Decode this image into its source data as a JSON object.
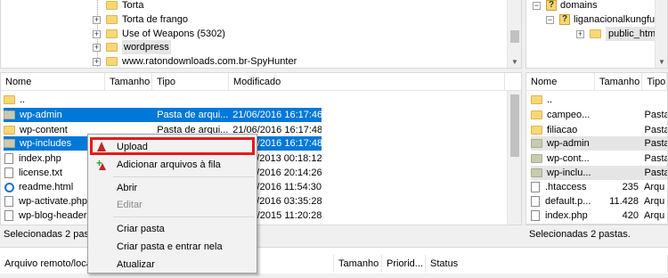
{
  "local_tree": {
    "items": [
      {
        "label": "Torta"
      },
      {
        "label": "Torta de frango"
      },
      {
        "label": "Use of Weapons (5302)"
      },
      {
        "label": "wordpress"
      },
      {
        "label": "www.ratondownloads.com.br-SpyHunter"
      }
    ]
  },
  "remote_tree": {
    "items": [
      {
        "label": "domains"
      },
      {
        "label": "liganacionalkungfu."
      },
      {
        "label": "public_html"
      }
    ]
  },
  "local_list": {
    "columns": [
      "Nome",
      "Tamanho",
      "Tipo",
      "Modificado"
    ],
    "rows": [
      {
        "name": "..",
        "size": "",
        "type": "",
        "modified": ""
      },
      {
        "name": "wp-admin",
        "size": "",
        "type": "Pasta de arqui...",
        "modified": "21/06/2016 16:17:46"
      },
      {
        "name": "wp-content",
        "size": "",
        "type": "Pasta de arqui...",
        "modified": "21/06/2016 16:17:48"
      },
      {
        "name": "wp-includes",
        "size": "",
        "type": "",
        "modified": "21/06/2016 16:17:48"
      },
      {
        "name": "index.php",
        "size": "",
        "type": "",
        "modified": "25/09/2013 00:18:12"
      },
      {
        "name": "license.txt",
        "size": "",
        "type": "",
        "modified": "21/06/2016 20:14:26"
      },
      {
        "name": "readme.html",
        "size": "",
        "type": "",
        "modified": "21/06/2016 11:54:30"
      },
      {
        "name": "wp-activate.php",
        "size": "",
        "type": "",
        "modified": "21/06/2016 03:35:28"
      },
      {
        "name": "wp-blog-header...",
        "size": "",
        "type": "",
        "modified": "19/12/2015 11:20:28"
      }
    ],
    "status": "Selecionadas 2 pastas."
  },
  "remote_list": {
    "columns": [
      "Nome",
      "Tamanho",
      "Tipo"
    ],
    "rows": [
      {
        "name": "..",
        "size": "",
        "type": ""
      },
      {
        "name": "campeo...",
        "size": "",
        "type": "Pasta"
      },
      {
        "name": "filiacao",
        "size": "",
        "type": "Pasta"
      },
      {
        "name": "wp-admin",
        "size": "",
        "type": "Pasta"
      },
      {
        "name": "wp-cont...",
        "size": "",
        "type": "Pasta"
      },
      {
        "name": "wp-inclu...",
        "size": "",
        "type": "Pasta"
      },
      {
        "name": ".htaccess",
        "size": "235",
        "type": "Arqu"
      },
      {
        "name": "default.p...",
        "size": "11.428",
        "type": "Arqu"
      },
      {
        "name": "index.php",
        "size": "420",
        "type": "Arqu"
      }
    ],
    "status": "Selecionadas 2 pastas."
  },
  "queue": {
    "columns": [
      "Arquivo remoto/loca",
      "Tamanho",
      "Priorid...",
      "Status"
    ]
  },
  "context_menu": {
    "items": [
      "Upload",
      "Adicionar arquivos à fila",
      "Abrir",
      "Editar",
      "Criar pasta",
      "Criar pasta e entrar nela",
      "Atualizar"
    ]
  },
  "colors": {
    "selection": "#0078d7",
    "highlight_box": "#e51a1a",
    "folder": "#f8d775"
  }
}
